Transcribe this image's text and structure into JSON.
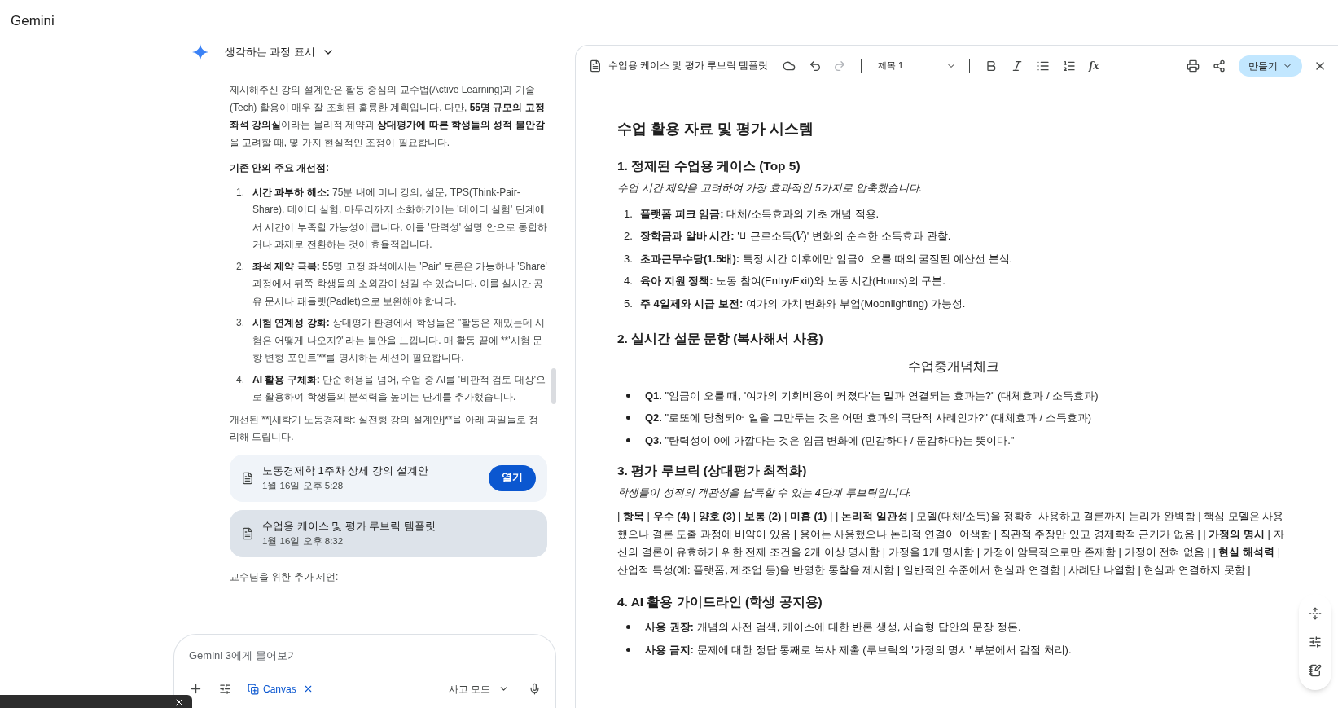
{
  "app": {
    "name": "Gemini"
  },
  "chat": {
    "thinking_toggle": {
      "label": "생각하는 과정 표시"
    },
    "intro": [
      {
        "t": "제시해주신 강의 설계안은 활동 중심의 교수법(Active Learning)과 기술(Tech) 활용이 매우 잘 조화된 훌륭한 계획입니다. 다만, "
      },
      {
        "t": "55명 규모의 고정 좌석 강의실",
        "b": true
      },
      {
        "t": "이라는 물리적 제약과 "
      },
      {
        "t": "상대평가에 따른 학생들의 성적 불안감",
        "b": true
      },
      {
        "t": "을 고려할 때, 몇 가지 현실적인 조정이 필요합니다."
      }
    ],
    "heading": "기존 안의 주요 개선점:",
    "points": [
      {
        "number": "1.",
        "parts": [
          {
            "t": "시간 과부하 해소:",
            "b": true
          },
          {
            "t": " 75분 내에 미니 강의, 설문, TPS(Think-Pair-Share), 데이터 실험, 마무리까지 소화하기에는 '데이터 실험' 단계에서 시간이 부족할 가능성이 큽니다. 이를 '탄력성' 설명 안으로 통합하거나 과제로 전환하는 것이 효율적입니다."
          }
        ]
      },
      {
        "number": "2.",
        "parts": [
          {
            "t": "좌석 제약 극복:",
            "b": true
          },
          {
            "t": " 55명 고정 좌석에서는 'Pair' 토론은 가능하나 'Share' 과정에서 뒤쪽 학생들의 소외감이 생길 수 있습니다. 이를 실시간 공유 문서나 패들렛(Padlet)으로 보완해야 합니다."
          }
        ]
      },
      {
        "number": "3.",
        "parts": [
          {
            "t": "시험 연계성 강화:",
            "b": true
          },
          {
            "t": " 상대평가 환경에서 학생들은 \"활동은 재밌는데 시험은 어떻게 나오지?\"라는 불안을 느낍니다. 매 활동 끝에 **'시험 문항 변형 포인트'**를 명시하는 세션이 필요합니다."
          }
        ]
      },
      {
        "number": "4.",
        "parts": [
          {
            "t": "AI 활용 구체화:",
            "b": true
          },
          {
            "t": " 단순 허용을 넘어, 수업 중 AI를 '비판적 검토 대상'으로 활용하여 학생들의 분석력을 높이는 단계를 추가했습니다."
          }
        ]
      }
    ],
    "closing": [
      {
        "t": "개선된 **[새학기 노동경제학: 실전형 강의 설계안]**을 아래 파일들로 정리해 드립니다."
      }
    ],
    "files": [
      {
        "title": "노동경제학 1주차 상세 강의 설계안",
        "date": "1월 16일 오후 5:28",
        "selected": false,
        "button": "열기"
      },
      {
        "title": "수업용 케이스 및 평가 루브릭 템플릿",
        "date": "1월 16일 오후 8:32",
        "selected": true
      }
    ],
    "subheading": "교수님을 위한 추가 제언:"
  },
  "composer": {
    "placeholder": "Gemini 3에게 물어보기",
    "tool_chip": "Canvas",
    "mode": "사고 모드"
  },
  "document": {
    "title": "수업용 케이스 및 평가 루브릭 템플릿",
    "style": "제목 1",
    "formula_button": "fx",
    "create_button": "만들기",
    "blocks": [
      {
        "kind": "title",
        "text": "수업 활용 자료 및 평가 시스템"
      },
      {
        "kind": "heading",
        "text": "1. 정제된 수업용 케이스 (Top 5)"
      },
      {
        "kind": "note",
        "text": "수업 시간 제약을 고려하여 가장 효과적인 5가지로 압축했습니다."
      },
      {
        "kind": "ordered",
        "items": [
          {
            "number": "1.",
            "parts": [
              {
                "t": "플랫폼 피크 임금:",
                "b": true
              },
              {
                "t": " 대체/소득효과의 기초 개념 적용."
              }
            ]
          },
          {
            "number": "2.",
            "parts": [
              {
                "t": "장학금과 알바 시간:",
                "b": true
              },
              {
                "t": " '비근로소득("
              },
              {
                "t": "V",
                "i": true
              },
              {
                "t": ")' 변화의 순수한 소득효과 관찰."
              }
            ]
          },
          {
            "number": "3.",
            "parts": [
              {
                "t": "초과근무수당(1.5배):",
                "b": true
              },
              {
                "t": " 특정 시간 이후에만 임금이 오를 때의 굴절된 예산선 분석."
              }
            ]
          },
          {
            "number": "4.",
            "parts": [
              {
                "t": "육아 지원 정책:",
                "b": true
              },
              {
                "t": " 노동 참여(Entry/Exit)와 노동 시간(Hours)의 구분."
              }
            ]
          },
          {
            "number": "5.",
            "parts": [
              {
                "t": "주 4일제와 시급 보전:",
                "b": true
              },
              {
                "t": " 여가의 가치 변화와 부업(Moonlighting) 가능성."
              }
            ]
          }
        ]
      },
      {
        "kind": "heading",
        "text": "2. 실시간 설문 문항 (복사해서 사용)"
      },
      {
        "kind": "center",
        "text": "수업중개념체크"
      },
      {
        "kind": "bullets",
        "items": [
          {
            "parts": [
              {
                "t": "Q1.",
                "b": true
              },
              {
                "t": " \"임금이 오를 때, '여가의 기회비용이 커졌다'는 말과 연결되는 효과는?\" (대체효과 / 소득효과)"
              }
            ]
          },
          {
            "parts": [
              {
                "t": "Q2.",
                "b": true
              },
              {
                "t": " \"로또에 당첨되어 일을 그만두는 것은 어떤 효과의 극단적 사례인가?\" (대체효과 / 소득효과)"
              }
            ]
          },
          {
            "parts": [
              {
                "t": "Q3.",
                "b": true
              },
              {
                "t": " \"탄력성이 0에 가깝다는 것은 임금 변화에 (민감하다 / 둔감하다)는 뜻이다.\""
              }
            ]
          }
        ]
      },
      {
        "kind": "heading",
        "text": "3. 평가 루브릭 (상대평가 최적화)"
      },
      {
        "kind": "note",
        "text": "학생들이 성적의 객관성을 납득할 수 있는 4단계 루브릭입니다."
      },
      {
        "kind": "paragraph",
        "parts": [
          {
            "t": "| "
          },
          {
            "t": "항목",
            "b": true
          },
          {
            "t": " | "
          },
          {
            "t": "우수 (4)",
            "b": true
          },
          {
            "t": " | "
          },
          {
            "t": "양호 (3)",
            "b": true
          },
          {
            "t": " | "
          },
          {
            "t": "보통 (2)",
            "b": true
          },
          {
            "t": " | "
          },
          {
            "t": "미흡 (1)",
            "b": true
          },
          {
            "t": " | | "
          },
          {
            "t": "논리적 일관성",
            "b": true
          },
          {
            "t": " | 모델(대체/소득)을 정확히 사용하고 결론까지 논리가 완벽함 | 핵심 모델은 사용했으나 결론 도출 과정에 비약이 있음 | 용어는 사용했으나 논리적 연결이 어색함 | 직관적 주장만 있고 경제학적 근거가 없음 | | "
          },
          {
            "t": "가정의 명시",
            "b": true
          },
          {
            "t": " | 자신의 결론이 유효하기 위한 전제 조건을 2개 이상 명시함 | 가정을 1개 명시함 | 가정이 암묵적으로만 존재함 | 가정이 전혀 없음 | | "
          },
          {
            "t": "현실 해석력",
            "b": true
          },
          {
            "t": " | 산업적 특성(예: 플랫폼, 제조업 등)을 반영한 통찰을 제시함 | 일반적인 수준에서 현실과 연결함 | 사례만 나열함 | 현실과 연결하지 못함 |"
          }
        ]
      },
      {
        "kind": "heading",
        "text": "4. AI 활용 가이드라인 (학생 공지용)"
      },
      {
        "kind": "bullets",
        "items": [
          {
            "parts": [
              {
                "t": "사용 권장:",
                "b": true
              },
              {
                "t": " 개념의 사전 검색, 케이스에 대한 반론 생성, 서술형 답안의 문장 정돈."
              }
            ]
          },
          {
            "parts": [
              {
                "t": "사용 금지:",
                "b": true
              },
              {
                "t": " 문제에 대한 정답 통째로 복사 제출 (루브릭의 '가정의 명시' 부분에서 감점 처리)."
              }
            ]
          }
        ]
      }
    ]
  }
}
